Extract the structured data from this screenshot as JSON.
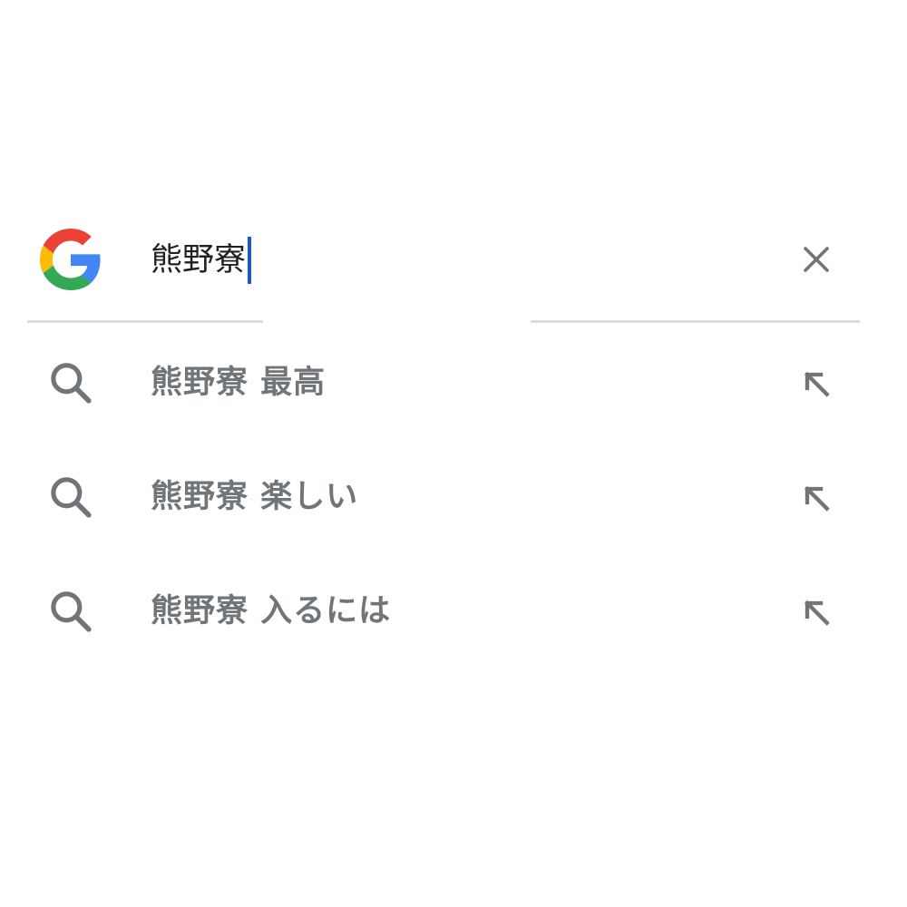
{
  "search": {
    "query": "熊野寮",
    "icons": {
      "logo": "google-g-icon",
      "clear": "close-icon"
    }
  },
  "suggestions": [
    {
      "label": "熊野寮 最高",
      "icon": "search-icon",
      "action_icon": "arrow-up-left-icon"
    },
    {
      "label": "熊野寮 楽しい",
      "icon": "search-icon",
      "action_icon": "arrow-up-left-icon"
    },
    {
      "label": "熊野寮 入るには",
      "icon": "search-icon",
      "action_icon": "arrow-up-left-icon"
    }
  ],
  "colors": {
    "caret": "#1a56db",
    "query_text": "#202124",
    "suggestion_text": "#70757a",
    "icon": "#70757a",
    "divider": "#dadce0",
    "google_blue": "#4285F4",
    "google_red": "#EA4335",
    "google_yellow": "#FBBC05",
    "google_green": "#34A853"
  }
}
